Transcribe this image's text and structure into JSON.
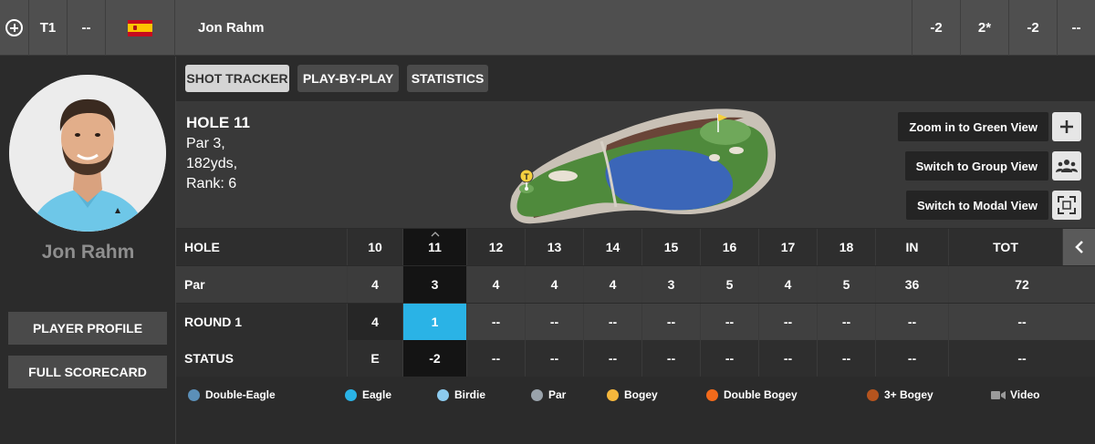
{
  "topbar": {
    "position": "T1",
    "movement": "--",
    "country_flag": "spain-flag",
    "player_name": "Jon Rahm",
    "scores": [
      "-2",
      "2*",
      "-2",
      "--"
    ]
  },
  "sidebar": {
    "player_name": "Jon Rahm",
    "profile_button": "PLAYER PROFILE",
    "scorecard_button": "FULL SCORECARD"
  },
  "tabs": [
    {
      "label": "SHOT TRACKER",
      "active": true
    },
    {
      "label": "PLAY-BY-PLAY",
      "active": false
    },
    {
      "label": "STATISTICS",
      "active": false
    }
  ],
  "hole": {
    "title": "HOLE 11",
    "par": "Par 3,",
    "yards": "182yds,",
    "rank": "Rank: 6"
  },
  "view_controls": [
    {
      "label": "Zoom in to Green View",
      "icon": "plus-icon"
    },
    {
      "label": "Switch to Group View",
      "icon": "group-icon"
    },
    {
      "label": "Switch to Modal View",
      "icon": "fullscreen-icon"
    }
  ],
  "scorecard": {
    "header_label": "HOLE",
    "holes": [
      "10",
      "11",
      "12",
      "13",
      "14",
      "15",
      "16",
      "17",
      "18",
      "IN",
      "TOT"
    ],
    "par_label": "Par",
    "par": [
      "4",
      "3",
      "4",
      "4",
      "4",
      "3",
      "5",
      "4",
      "5",
      "36",
      "72"
    ],
    "round_label": "ROUND 1",
    "round": [
      "4",
      "1",
      "--",
      "--",
      "--",
      "--",
      "--",
      "--",
      "--",
      "--",
      "--"
    ],
    "status_label": "STATUS",
    "status": [
      "E",
      "-2",
      "--",
      "--",
      "--",
      "--",
      "--",
      "--",
      "--",
      "--",
      "--"
    ]
  },
  "legend": [
    {
      "label": "Double-Eagle",
      "color": "#5b8fb8"
    },
    {
      "label": "Eagle",
      "color": "#2ab3e6"
    },
    {
      "label": "Birdie",
      "color": "#8ccbef"
    },
    {
      "label": "Par",
      "color": "#9aa3ab"
    },
    {
      "label": "Bogey",
      "color": "#f6b73c"
    },
    {
      "label": "Double Bogey",
      "color": "#f26a1b"
    },
    {
      "label": "3+ Bogey",
      "color": "#b5541e"
    },
    {
      "label": "Video",
      "icon": "video-icon"
    }
  ]
}
